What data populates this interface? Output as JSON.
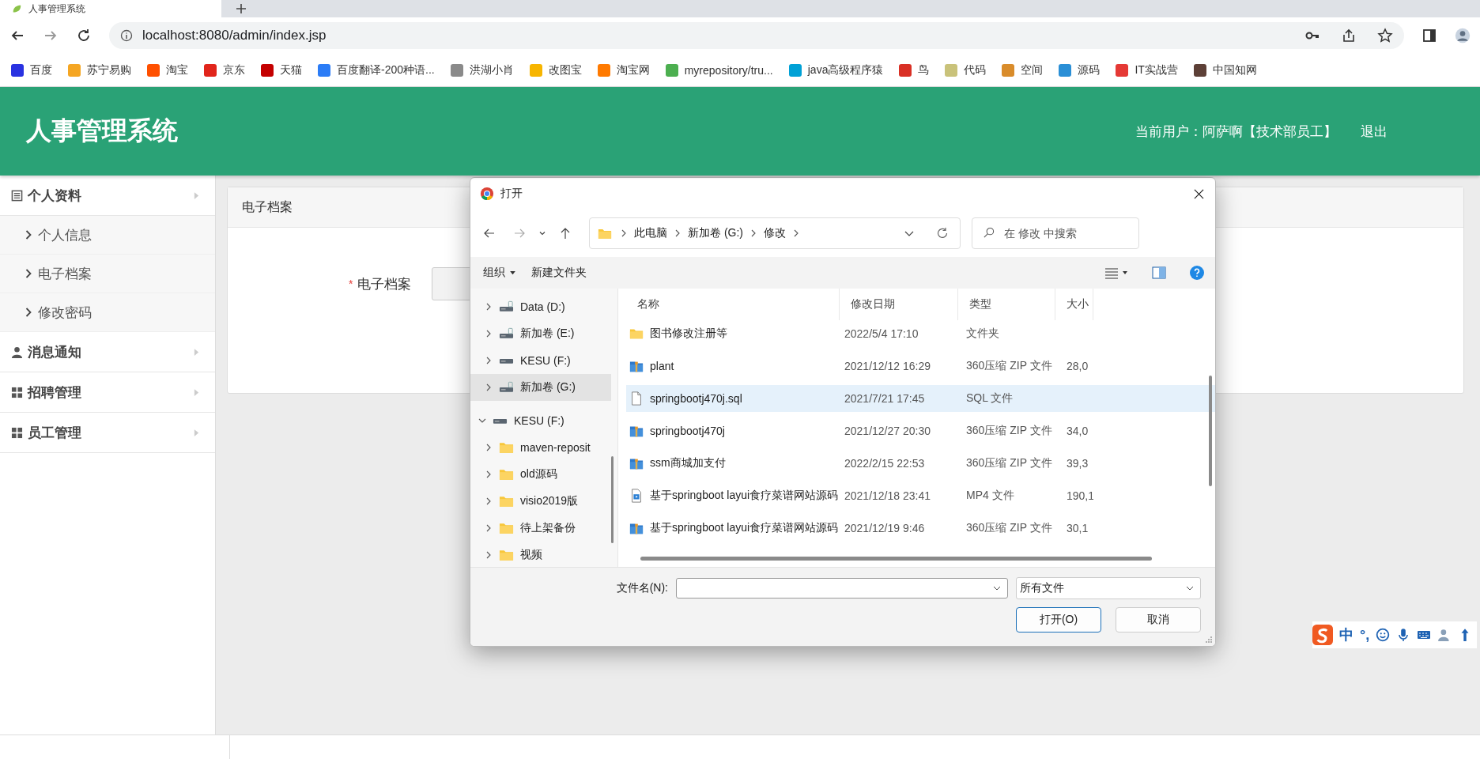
{
  "browser": {
    "tab_title": "人事管理系统",
    "url": "localhost:8080/admin/index.jsp",
    "bookmarks": [
      {
        "label": "百度",
        "color": "#2932e1"
      },
      {
        "label": "苏宁易购",
        "color": "#f5a623"
      },
      {
        "label": "淘宝",
        "color": "#ff5000"
      },
      {
        "label": "京东",
        "color": "#e1251b"
      },
      {
        "label": "天猫",
        "color": "#c40000"
      },
      {
        "label": "百度翻译-200种语...",
        "color": "#2b7cf6"
      },
      {
        "label": "洪湖小肖",
        "color": "#8a8a8a"
      },
      {
        "label": "改图宝",
        "color": "#f7b500"
      },
      {
        "label": "淘宝网",
        "color": "#ff7a00"
      },
      {
        "label": "myrepository/tru...",
        "color": "#4caf50"
      },
      {
        "label": "java高级程序猿",
        "color": "#00a1d6"
      },
      {
        "label": "鸟",
        "color": "#d93025"
      },
      {
        "label": "代码",
        "color": "#c9c27a"
      },
      {
        "label": "空间",
        "color": "#d98c2b"
      },
      {
        "label": "源码",
        "color": "#2a8fd6"
      },
      {
        "label": "IT实战营",
        "color": "#e53935"
      },
      {
        "label": "中国知网",
        "color": "#5d4037"
      }
    ]
  },
  "header": {
    "title": "人事管理系统",
    "user": "当前用户：阿萨啊【技术部员工】",
    "logout": "退出"
  },
  "sidebar": [
    {
      "label": "个人资料",
      "kind": "list",
      "children": [
        {
          "label": "个人信息"
        },
        {
          "label": "电子档案"
        },
        {
          "label": "修改密码"
        }
      ]
    },
    {
      "label": "消息通知",
      "kind": "user"
    },
    {
      "label": "招聘管理",
      "kind": "grid"
    },
    {
      "label": "员工管理",
      "kind": "grid"
    }
  ],
  "panel": {
    "title": "电子档案",
    "field_label": "电子档案",
    "required_mark": "*"
  },
  "dialog": {
    "title": "打开",
    "path": [
      "此电脑",
      "新加卷 (G:)",
      "修改"
    ],
    "search_placeholder": "在 修改 中搜索",
    "toolbar": {
      "organize": "组织",
      "new_folder": "新建文件夹"
    },
    "tree": [
      {
        "label": "Data (D:)",
        "kind": "drive",
        "selected": false,
        "expanded": false
      },
      {
        "label": "新加卷 (E:)",
        "kind": "drive",
        "selected": false,
        "expanded": false
      },
      {
        "label": "KESU  (F:)",
        "kind": "usb",
        "selected": false,
        "expanded": false
      },
      {
        "label": "新加卷 (G:)",
        "kind": "drive",
        "selected": true,
        "expanded": false
      },
      {
        "label": "KESU  (F:)",
        "kind": "usb",
        "selected": false,
        "expanded": true,
        "children": [
          {
            "label": "maven-reposit",
            "kind": "folder",
            "selected": false,
            "expanded": false
          },
          {
            "label": "old源码",
            "kind": "folder",
            "selected": false,
            "expanded": false
          },
          {
            "label": "visio2019版",
            "kind": "folder",
            "selected": false,
            "expanded": false
          },
          {
            "label": "待上架备份",
            "kind": "folder",
            "selected": false,
            "expanded": false
          },
          {
            "label": "视频",
            "kind": "folder",
            "selected": false,
            "expanded": false
          }
        ]
      }
    ],
    "columns": [
      "名称",
      "修改日期",
      "类型",
      "大小"
    ],
    "files": [
      {
        "name": "图书修改注册等",
        "date": "2022/5/4 17:10",
        "type": "文件夹",
        "kind": "folder",
        "selected": false
      },
      {
        "name": "plant",
        "date": "2021/12/12 16:29",
        "type": "360压缩 ZIP 文件",
        "size": "28,0",
        "kind": "zip",
        "selected": false
      },
      {
        "name": "springbootj470j.sql",
        "date": "2021/7/21 17:45",
        "type": "SQL 文件",
        "kind": "file",
        "selected": true
      },
      {
        "name": "springbootj470j",
        "date": "2021/12/27 20:30",
        "type": "360压缩 ZIP 文件",
        "size": "34,0",
        "kind": "zip",
        "selected": false
      },
      {
        "name": "ssm商城加支付",
        "date": "2022/2/15 22:53",
        "type": "360压缩 ZIP 文件",
        "size": "39,3",
        "kind": "zip",
        "selected": false
      },
      {
        "name": "基于springboot  layui食疗菜谱网站源码",
        "date": "2021/12/18 23:41",
        "type": "MP4 文件",
        "size": "190,1",
        "kind": "video",
        "selected": false
      },
      {
        "name": "基于springboot  layui食疗菜谱网站源码",
        "date": "2021/12/19 9:46",
        "type": "360压缩 ZIP 文件",
        "size": "30,1",
        "kind": "zip",
        "selected": false
      }
    ],
    "filename_label": "文件名(N):",
    "filter": "所有文件",
    "buttons": [
      {
        "label": "打开(O)",
        "kind": "primary"
      },
      {
        "label": "取消",
        "kind": "normal"
      }
    ]
  },
  "ime": {
    "mode": "中",
    "punct": "°,"
  }
}
